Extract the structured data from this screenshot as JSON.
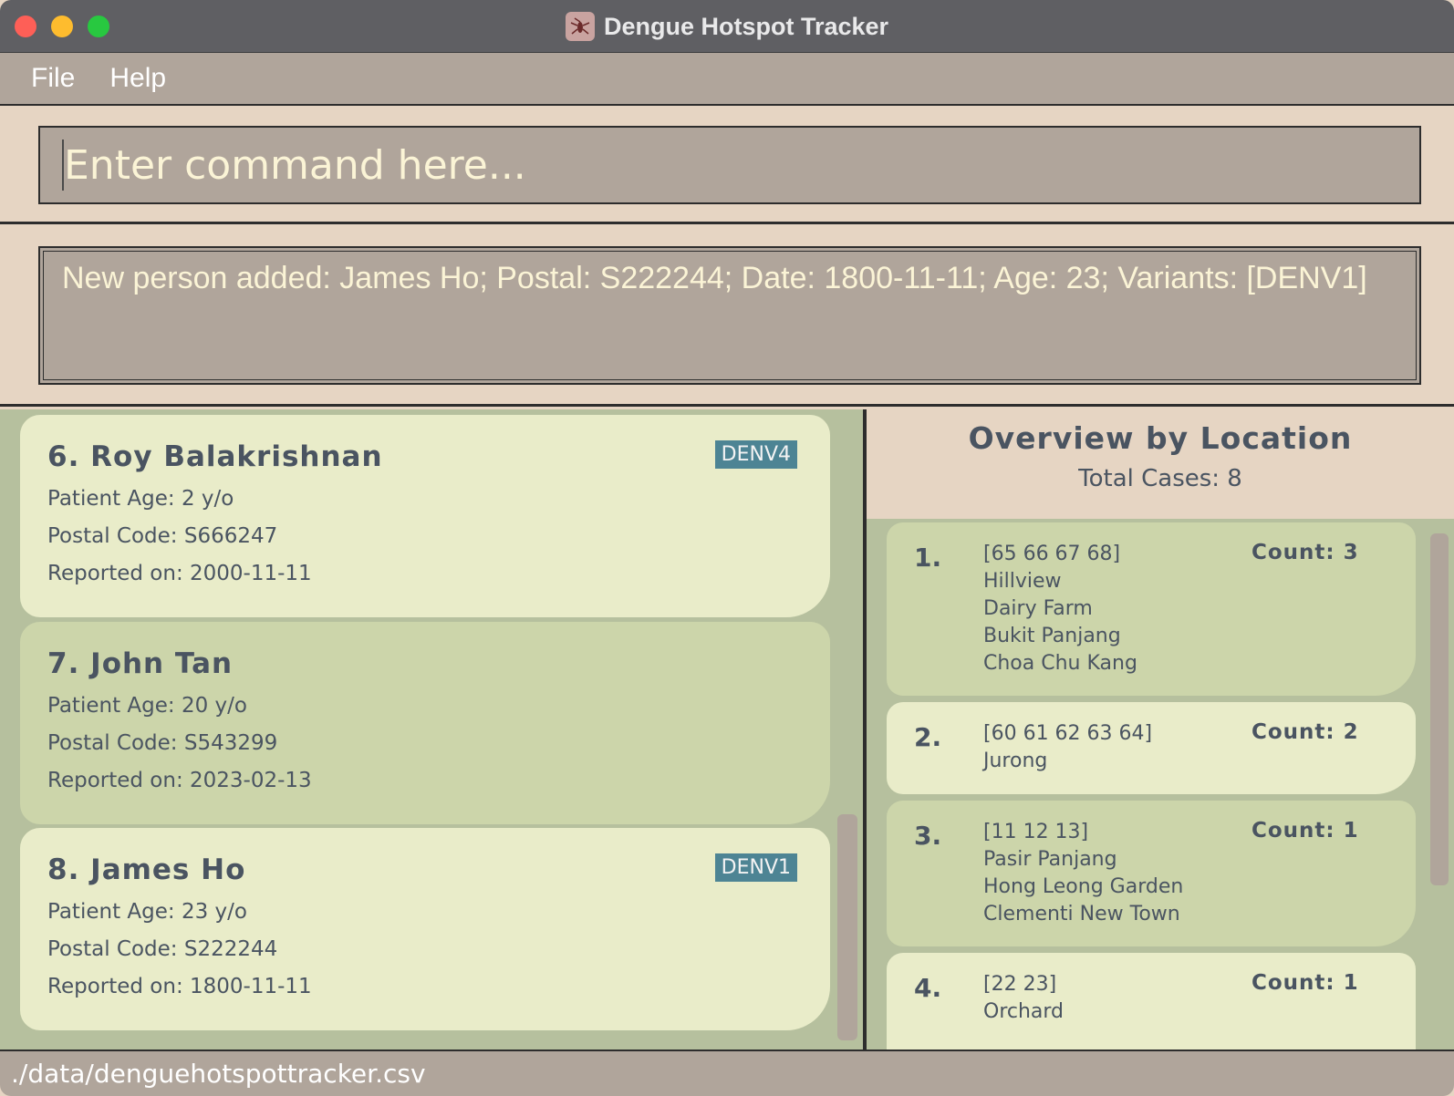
{
  "window": {
    "title": "Dengue Hotspot Tracker",
    "icon": "mosquito-icon"
  },
  "menu": {
    "items": [
      "File",
      "Help"
    ]
  },
  "command": {
    "placeholder": "Enter command here...",
    "value": ""
  },
  "result": {
    "text": "New person added: James Ho; Postal: S222244; Date: 1800-11-11; Age: 23; Variants: [DENV1]"
  },
  "persons": [
    {
      "index": "6.",
      "name": "Roy Balakrishnan",
      "age": "Patient Age: 2 y/o",
      "postal": "Postal Code: S666247",
      "date": "Reported on: 2000-11-11",
      "variant": "DENV4"
    },
    {
      "index": "7.",
      "name": "John Tan",
      "age": "Patient Age: 20 y/o",
      "postal": "Postal Code: S543299",
      "date": "Reported on: 2023-02-13",
      "variant": ""
    },
    {
      "index": "8.",
      "name": "James Ho",
      "age": "Patient Age: 23 y/o",
      "postal": "Postal Code: S222244",
      "date": "Reported on: 1800-11-11",
      "variant": "DENV1"
    }
  ],
  "overview": {
    "title": "Overview by Location",
    "total": "Total Cases: 8",
    "locations": [
      {
        "index": "1.",
        "sectors": "[65 66 67 68]",
        "areas": [
          "Hillview",
          "Dairy Farm",
          "Bukit Panjang",
          "Choa Chu Kang"
        ],
        "count": "Count: 3"
      },
      {
        "index": "2.",
        "sectors": "[60 61 62 63 64]",
        "areas": [
          "Jurong"
        ],
        "count": "Count: 2"
      },
      {
        "index": "3.",
        "sectors": "[11 12 13]",
        "areas": [
          "Pasir Panjang",
          "Hong Leong Garden",
          "Clementi New Town"
        ],
        "count": "Count: 1"
      },
      {
        "index": "4.",
        "sectors": "[22 23]",
        "areas": [
          "Orchard"
        ],
        "count": "Count: 1"
      }
    ]
  },
  "status": {
    "path": "./data/denguehotspottracker.csv"
  },
  "colors": {
    "variant_tag": "#4d8494",
    "card_light": "#e9ecc9",
    "card_dark": "#ccd5aa",
    "panel_bg": "#b6c09e",
    "bar_bg": "#b0a59b"
  }
}
